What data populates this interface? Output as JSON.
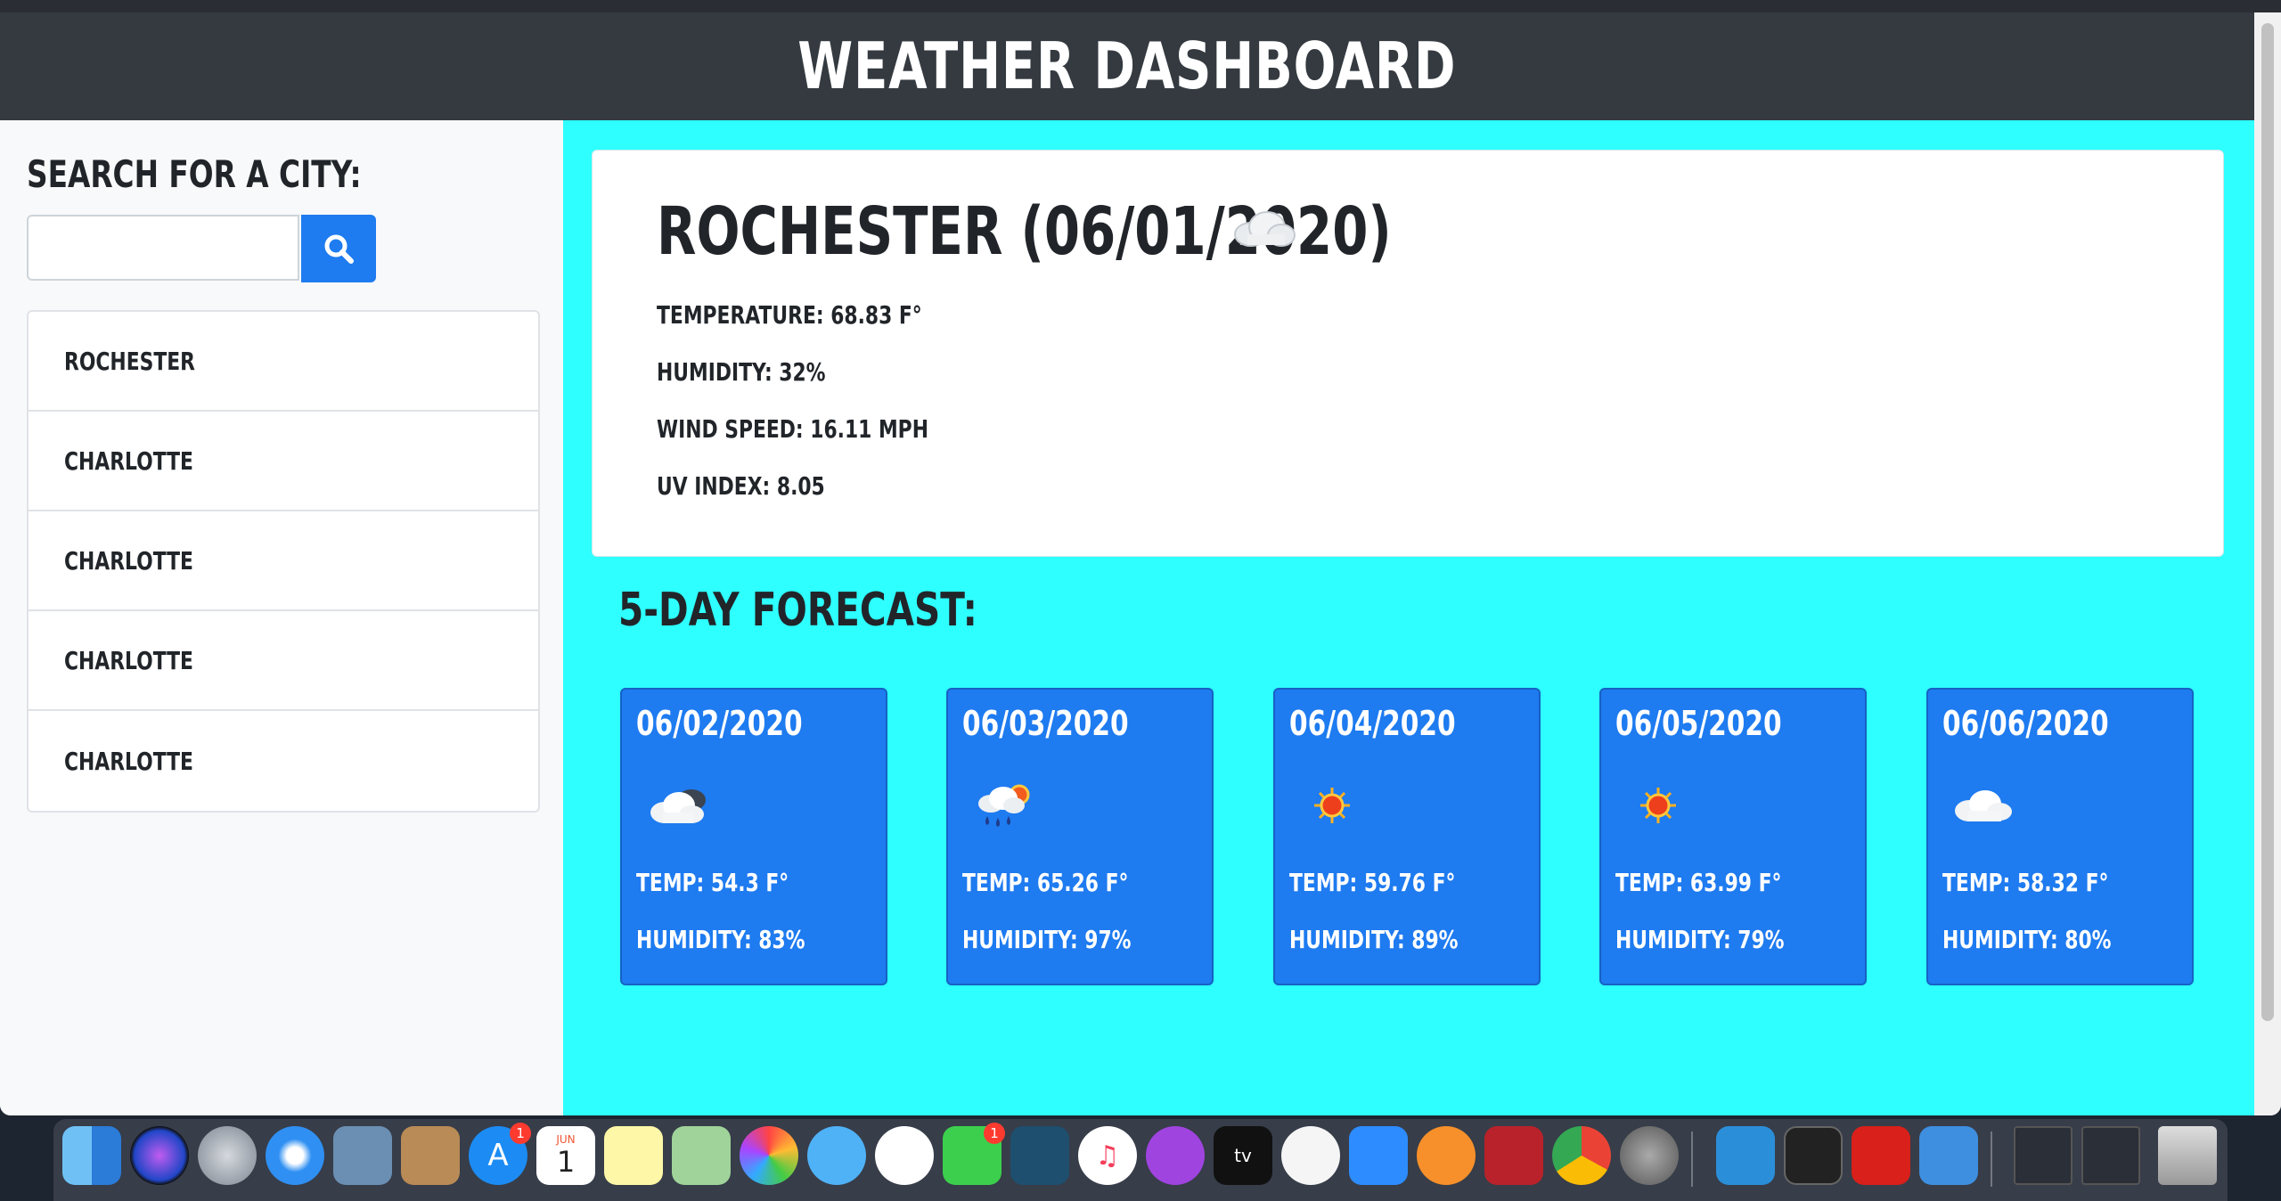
{
  "header": {
    "title": "WEATHER DASHBOARD"
  },
  "sidebar": {
    "search_title": "SEARCH FOR A CITY:",
    "search_value": "",
    "cities": [
      "ROCHESTER",
      "CHARLOTTE",
      "CHARLOTTE",
      "CHARLOTTE",
      "CHARLOTTE"
    ]
  },
  "current": {
    "title": "ROCHESTER (06/01/2020)",
    "icon": "cloud-icon",
    "temperature": "TEMPERATURE: 68.83 F°",
    "humidity": "HUMIDITY: 32%",
    "wind": "WIND SPEED: 16.11 MPH",
    "uv": "UV INDEX: 8.05"
  },
  "forecast": {
    "title": "5-DAY FORECAST:",
    "days": [
      {
        "date": "06/02/2020",
        "icon": "partly-cloudy-night-icon",
        "temp": "TEMP: 54.3 F°",
        "humidity": "HUMIDITY: 83%"
      },
      {
        "date": "06/03/2020",
        "icon": "rain-sun-icon",
        "temp": "TEMP: 65.26 F°",
        "humidity": "HUMIDITY: 97%"
      },
      {
        "date": "06/04/2020",
        "icon": "sun-icon",
        "temp": "TEMP: 59.76 F°",
        "humidity": "HUMIDITY: 89%"
      },
      {
        "date": "06/05/2020",
        "icon": "sun-icon",
        "temp": "TEMP: 63.99 F°",
        "humidity": "HUMIDITY: 79%"
      },
      {
        "date": "06/06/2020",
        "icon": "cloud-icon",
        "temp": "TEMP: 58.32 F°",
        "humidity": "HUMIDITY: 80%"
      }
    ]
  },
  "dock": {
    "calendar_month": "JUN",
    "calendar_day": "1",
    "appstore_badge": "1",
    "facetime_badge": "1",
    "tv_label": "tv",
    "icons": [
      "finder-icon",
      "siri-icon",
      "launchpad-icon",
      "safari-icon",
      "preview-icon",
      "contacts-icon",
      "appstore-icon",
      "calendar-icon",
      "notes-icon",
      "maps-icon",
      "photos-icon",
      "messages-icon",
      "slack-icon",
      "facetime-icon",
      "mysql-icon",
      "music-icon",
      "podcasts-icon",
      "tv-icon",
      "news-icon",
      "zoom-icon",
      "books-icon",
      "photobooth-icon",
      "chrome-icon",
      "system-preferences-icon",
      "vscode-icon",
      "terminal-icon",
      "acrobat-icon",
      "xcode-icon",
      "window-thumbnail-icon",
      "window-thumbnail-icon",
      "trash-icon"
    ]
  }
}
